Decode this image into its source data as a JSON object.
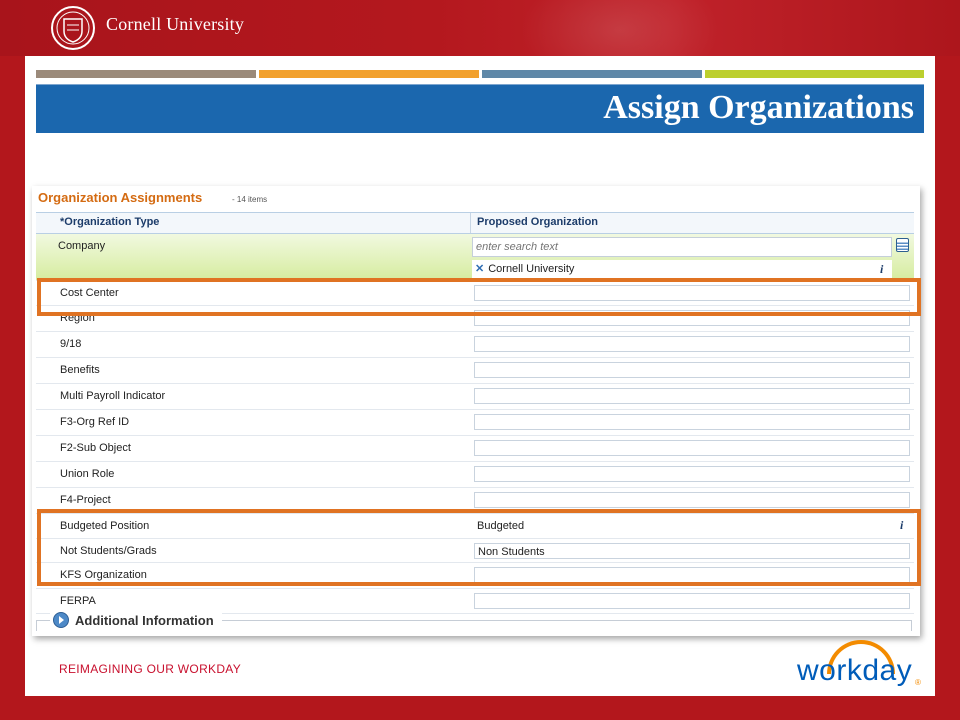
{
  "header": {
    "brand": "Cornell University",
    "seal_icon": "cornell-seal-icon"
  },
  "slide": {
    "title": "Assign Organizations",
    "stripes": [
      "#9b8a7a",
      "#f2a12e",
      "#5f88a8",
      "#bccf2e"
    ],
    "title_bar_color": "#1b67ae"
  },
  "panel": {
    "title": "Organization Assignments",
    "count": "- 14 items",
    "columns": {
      "type": "*Organization Type",
      "org": "Proposed Organization"
    },
    "company": {
      "label": "Company",
      "search_placeholder": "enter search text",
      "selected": "Cornell University"
    },
    "rows": [
      {
        "label": "Cost Center",
        "value": ""
      },
      {
        "label": "Region",
        "value": ""
      },
      {
        "label": "9/18",
        "value": ""
      },
      {
        "label": "Benefits",
        "value": ""
      },
      {
        "label": "Multi Payroll Indicator",
        "value": ""
      },
      {
        "label": "F3-Org Ref ID",
        "value": ""
      },
      {
        "label": "F2-Sub Object",
        "value": ""
      },
      {
        "label": "Union Role",
        "value": ""
      },
      {
        "label": "F4-Project",
        "value": ""
      },
      {
        "label": "Budgeted Position",
        "value": "Budgeted"
      },
      {
        "label": "Not Students/Grads",
        "value": "Non Students"
      },
      {
        "label": "KFS Organization",
        "value": ""
      },
      {
        "label": "FERPA",
        "value": ""
      }
    ],
    "additional": "Additional Information"
  },
  "footer": {
    "text": "REIMAGINING  OUR WORKDAY",
    "logo": "workday",
    "logo_dot": "®"
  },
  "colors": {
    "accent_orange": "#e07323",
    "cornell_red": "#b3171c",
    "workday_blue": "#005cb9",
    "workday_orange": "#f38b00"
  }
}
